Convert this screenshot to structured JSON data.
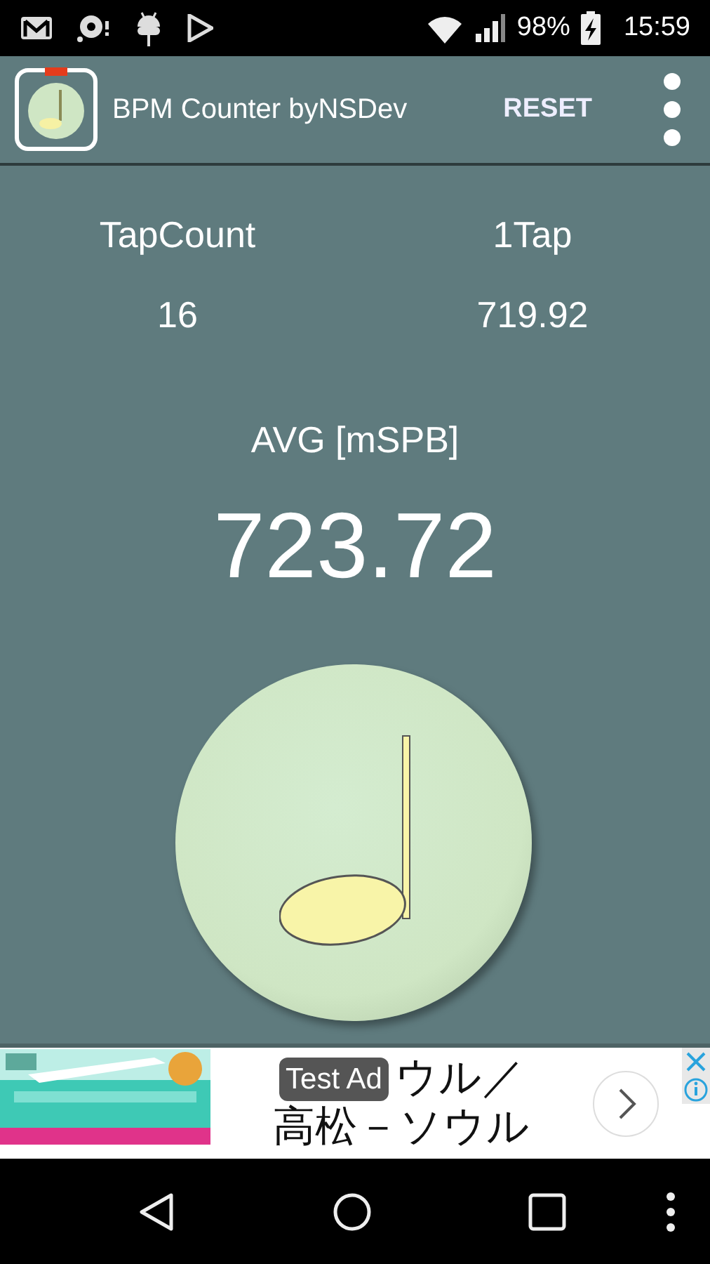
{
  "status_bar": {
    "battery_text": "98%",
    "time": "15:59"
  },
  "app_bar": {
    "title": "BPM Counter byNSDev",
    "action": "RESET"
  },
  "stats": [
    {
      "label": "TapCount",
      "value": "16"
    },
    {
      "label": "1Tap",
      "value": "719.92"
    }
  ],
  "average": {
    "label": "AVG [mSPB]",
    "value": "723.72"
  },
  "ad": {
    "badge": "Test Ad",
    "headline_lines": [
      "ウル／",
      "高松－ソウル"
    ]
  }
}
